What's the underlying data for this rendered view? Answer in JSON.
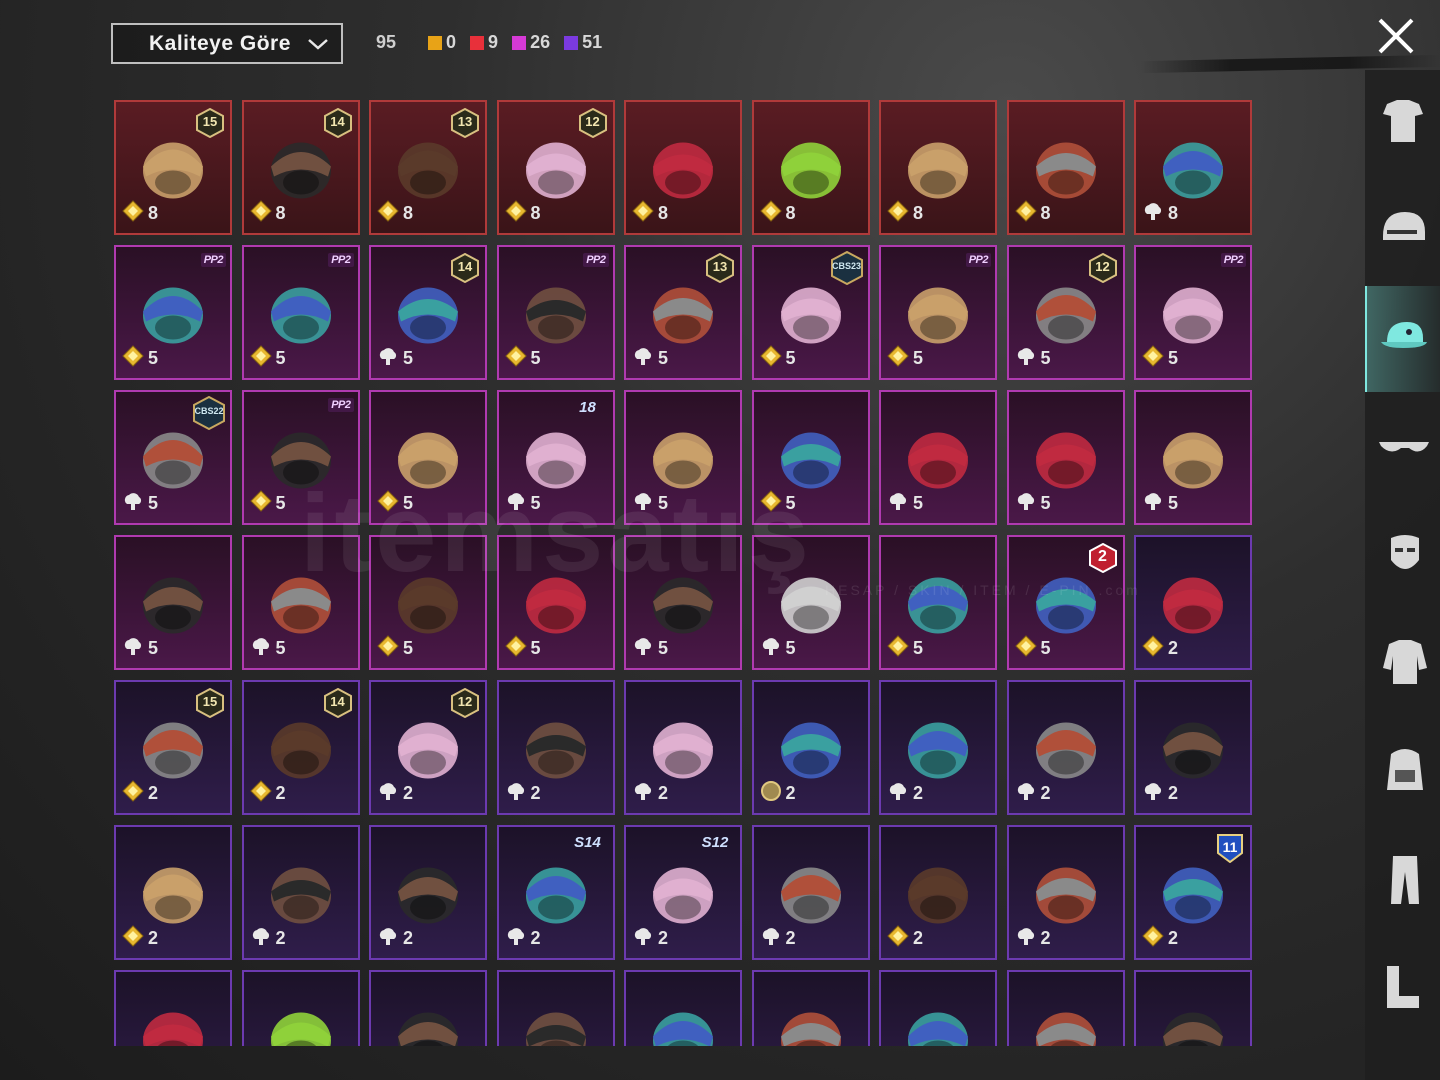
{
  "header": {
    "sort_label": "Kaliteye Göre",
    "total": "95",
    "counts": [
      {
        "color": "#e8a317",
        "value": "0"
      },
      {
        "color": "#e8303a",
        "value": "9"
      },
      {
        "color": "#d63ad6",
        "value": "26"
      },
      {
        "color": "#7b3ae0",
        "value": "51"
      }
    ]
  },
  "watermark": {
    "main": "itemsatış",
    "sub": "HESAP / SKIN / ITEM / E-PIN .com"
  },
  "items": [
    {
      "q": "red",
      "badge": "15",
      "count": "8",
      "icon": "pink-blonde-hair",
      "cur": "gold"
    },
    {
      "q": "red",
      "badge": "14",
      "count": "8",
      "icon": "wolf-ears-mask",
      "cur": "gold"
    },
    {
      "q": "red",
      "badge": "13",
      "count": "8",
      "icon": "ribbon-hat",
      "cur": "gold"
    },
    {
      "q": "red",
      "badge": "12",
      "count": "8",
      "icon": "silver-bun-hair",
      "cur": "gold"
    },
    {
      "q": "red",
      "badge": "",
      "count": "8",
      "icon": "teal-dragon-helmet",
      "cur": "gold"
    },
    {
      "q": "red",
      "badge": "",
      "count": "8",
      "icon": "anubis-helmet",
      "cur": "gold"
    },
    {
      "q": "red",
      "badge": "",
      "count": "8",
      "icon": "green-crystal-helmet",
      "cur": "gold"
    },
    {
      "q": "red",
      "badge": "",
      "count": "8",
      "icon": "pharaoh-helmet",
      "cur": "gold"
    },
    {
      "q": "red",
      "badge": "",
      "count": "8",
      "icon": "tricorn-hat",
      "cur": "cloud"
    },
    {
      "q": "pink",
      "tag": "PP2",
      "count": "5",
      "icon": "pink-bow-headband",
      "cur": "gold"
    },
    {
      "q": "pink",
      "tag": "PP2",
      "count": "5",
      "icon": "yellow-box-mask",
      "cur": "gold"
    },
    {
      "q": "pink",
      "badge": "14",
      "count": "5",
      "icon": "brown-hair",
      "cur": "cloud"
    },
    {
      "q": "pink",
      "tag": "PP2",
      "count": "5",
      "icon": "black-ribbon-hair",
      "cur": "gold"
    },
    {
      "q": "pink",
      "badge": "13",
      "count": "5",
      "icon": "aviator-cap",
      "cur": "cloud"
    },
    {
      "q": "pink",
      "hex": "CBS23",
      "count": "5",
      "icon": "cat-headphones",
      "cur": "gold"
    },
    {
      "q": "pink",
      "tag": "PP2",
      "count": "5",
      "icon": "cap-with-glasses",
      "cur": "gold"
    },
    {
      "q": "pink",
      "badge": "12",
      "count": "5",
      "icon": "ponytail-hair",
      "cur": "cloud"
    },
    {
      "q": "pink",
      "tag": "PP2",
      "count": "5",
      "icon": "llama-mask",
      "cur": "gold"
    },
    {
      "q": "pink",
      "hex": "CBS22",
      "count": "5",
      "icon": "purple-hair",
      "cur": "cloud"
    },
    {
      "q": "pink",
      "tag": "PP2",
      "count": "5",
      "icon": "panda-mask",
      "cur": "gold"
    },
    {
      "q": "pink",
      "badge": "",
      "count": "5",
      "icon": "neon-helmet",
      "cur": "gold"
    },
    {
      "q": "pink",
      "sbadge": "18",
      "count": "5",
      "icon": "pink-spiked-cap",
      "cur": "cloud"
    },
    {
      "q": "pink",
      "badge": "",
      "count": "5",
      "icon": "green-lantern-hat",
      "cur": "cloud"
    },
    {
      "q": "pink",
      "badge": "",
      "count": "5",
      "icon": "zebra-mask",
      "cur": "gold"
    },
    {
      "q": "pink",
      "badge": "",
      "count": "5",
      "icon": "bunny-astronaut-helmet",
      "cur": "cloud"
    },
    {
      "q": "pink",
      "badge": "",
      "count": "5",
      "icon": "sheep-mask",
      "cur": "cloud"
    },
    {
      "q": "pink",
      "badge": "",
      "count": "5",
      "icon": "goggles-helmet",
      "cur": "cloud"
    },
    {
      "q": "pink",
      "badge": "",
      "count": "5",
      "icon": "cyber-helmet",
      "cur": "cloud"
    },
    {
      "q": "pink",
      "badge": "",
      "count": "5",
      "icon": "gorilla-mask",
      "cur": "cloud"
    },
    {
      "q": "pink",
      "badge": "",
      "count": "5",
      "icon": "crab-hat",
      "cur": "gold"
    },
    {
      "q": "pink",
      "badge": "",
      "count": "5",
      "icon": "robot-helmet",
      "cur": "gold"
    },
    {
      "q": "pink",
      "badge": "",
      "count": "5",
      "icon": "top-hat",
      "cur": "cloud"
    },
    {
      "q": "pink",
      "badge": "",
      "count": "5",
      "icon": "werewolf-mask",
      "cur": "cloud"
    },
    {
      "q": "pink",
      "badge": "",
      "count": "5",
      "icon": "maid-headband",
      "cur": "gold"
    },
    {
      "q": "pink",
      "rbadge": "2",
      "count": "5",
      "icon": "rabbit-mask",
      "cur": "gold"
    },
    {
      "q": "purple",
      "badge": "",
      "count": "2",
      "icon": "silver-hair",
      "cur": "gold"
    },
    {
      "q": "purple",
      "badge": "15",
      "count": "2",
      "icon": "pumpkin-hair",
      "cur": "gold"
    },
    {
      "q": "purple",
      "badge": "14",
      "count": "2",
      "icon": "cat-cap-hair",
      "cur": "gold"
    },
    {
      "q": "purple",
      "badge": "12",
      "count": "2",
      "icon": "bunny-ears-helmet",
      "cur": "cloud"
    },
    {
      "q": "purple",
      "badge": "",
      "count": "2",
      "icon": "baseball-cap",
      "cur": "cloud"
    },
    {
      "q": "purple",
      "badge": "",
      "count": "2",
      "icon": "gas-mask-helmet",
      "cur": "cloud"
    },
    {
      "q": "purple",
      "badge": "",
      "count": "2",
      "icon": "goggles-red-hair",
      "cur": "coin"
    },
    {
      "q": "purple",
      "badge": "",
      "count": "2",
      "icon": "devil-horns",
      "cur": "cloud"
    },
    {
      "q": "purple",
      "badge": "",
      "count": "2",
      "icon": "bucket-hat-red-hair",
      "cur": "cloud"
    },
    {
      "q": "purple",
      "badge": "",
      "count": "2",
      "icon": "witch-hat",
      "cur": "cloud"
    },
    {
      "q": "purple",
      "badge": "",
      "count": "2",
      "icon": "grey-cap",
      "cur": "gold"
    },
    {
      "q": "purple",
      "badge": "",
      "count": "2",
      "icon": "conical-hat",
      "cur": "cloud"
    },
    {
      "q": "purple",
      "badge": "",
      "count": "2",
      "icon": "red-black-helmet",
      "cur": "cloud"
    },
    {
      "q": "purple",
      "sbadge": "S14",
      "count": "2",
      "icon": "gladiator-helmet",
      "cur": "cloud"
    },
    {
      "q": "purple",
      "sbadge": "S12",
      "count": "2",
      "icon": "space-helmet",
      "cur": "cloud"
    },
    {
      "q": "purple",
      "badge": "",
      "count": "2",
      "icon": "blue-beanie",
      "cur": "cloud"
    },
    {
      "q": "purple",
      "badge": "",
      "count": "2",
      "icon": "pink-moto-helmet",
      "cur": "gold"
    },
    {
      "q": "purple",
      "badge": "",
      "count": "2",
      "icon": "dark-beanie",
      "cur": "cloud"
    },
    {
      "q": "purple",
      "bbadge": "11",
      "count": "2",
      "icon": "camo-bucket-hat",
      "cur": "gold"
    },
    {
      "q": "purple",
      "badge": "",
      "count": "",
      "icon": "black-cap",
      "cur": ""
    },
    {
      "q": "purple",
      "badge": "",
      "count": "",
      "icon": "white-turban",
      "cur": ""
    },
    {
      "q": "purple",
      "badge": "",
      "count": "",
      "icon": "blue-turban",
      "cur": ""
    },
    {
      "q": "purple",
      "badge": "",
      "count": "",
      "icon": "straw-hat",
      "cur": ""
    },
    {
      "q": "purple",
      "badge": "",
      "count": "",
      "icon": "red-helmet",
      "cur": ""
    },
    {
      "q": "purple",
      "badge": "",
      "count": "",
      "icon": "white-feather-hat",
      "cur": ""
    },
    {
      "q": "purple",
      "badge": "",
      "count": "",
      "icon": "dark-cap",
      "cur": ""
    },
    {
      "q": "purple",
      "badge": "",
      "count": "",
      "icon": "balaclava",
      "cur": ""
    },
    {
      "q": "purple",
      "badge": "",
      "count": "",
      "icon": "wrestler-mask",
      "cur": ""
    }
  ],
  "sidebar": [
    {
      "icon": "outfit-icon"
    },
    {
      "icon": "helmet-icon"
    },
    {
      "icon": "cap-icon",
      "selected": true
    },
    {
      "icon": "glasses-icon"
    },
    {
      "icon": "face-mask-icon"
    },
    {
      "icon": "jacket-icon"
    },
    {
      "icon": "backpack-icon"
    },
    {
      "icon": "pants-icon"
    },
    {
      "icon": "boots-icon"
    }
  ]
}
